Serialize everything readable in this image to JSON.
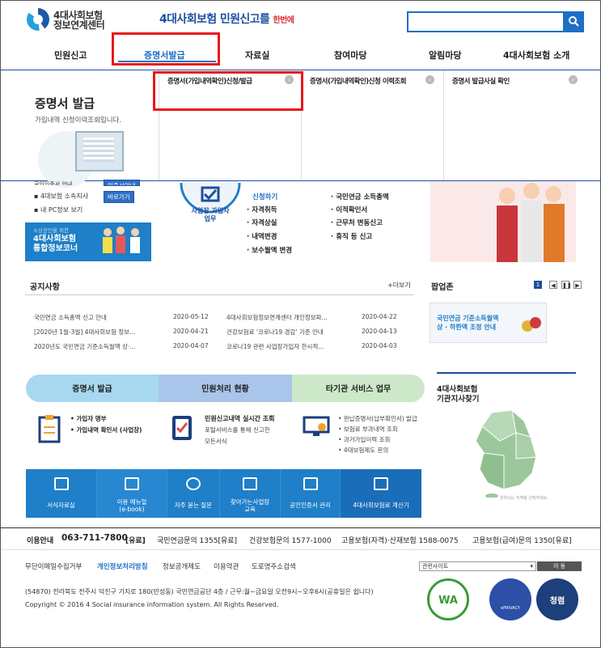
{
  "header": {
    "logo_line1": "4대사회보험",
    "logo_line2": "정보연계센터",
    "slogan_main": "4대사회보험 민원신고를",
    "slogan_small": "한번에",
    "search_placeholder": ""
  },
  "gnb": [
    "민원신고",
    "증명서발급",
    "자료실",
    "참여마당",
    "알림마당",
    "4대사회보험 소개"
  ],
  "dropdown": {
    "title": "증명서 발급",
    "subtitle": "가입내역 신청이력조회입니다.",
    "columns": [
      "증명서(가입내역확인)신청/발급",
      "증명서(가입내역확인)신청 이력조회",
      "증명서 발급사실 확인"
    ]
  },
  "side": {
    "items": [
      "공인인증서 안내",
      "4대보험 소속지사",
      "내 PC정보 보기"
    ],
    "btn1": "인증서안내",
    "btn2": "바로가기",
    "banner_small": "소상공인을 위한",
    "banner_big1": "4대사회보험",
    "banner_big2": "통합정보코너"
  },
  "biz": {
    "badge_line1": "사업장 가입자",
    "badge_line2": "업무",
    "col1": [
      "신청하기",
      "자격취득",
      "자격상실",
      "내역변경",
      "보수월액 변경"
    ],
    "col2": [
      "국민연금 소득총액",
      "이적확인서",
      "근무처 변동신고",
      "휴직 등 신고"
    ]
  },
  "notice": {
    "title": "공지사항",
    "more": "+더보기",
    "rows": [
      [
        "국민연금 소득총액 신고 안내",
        "2020-05-12",
        "4대사회보험정보연계센터 개인정보파...",
        "2020-04-22"
      ],
      [
        "[2020년 1월-3월] 4대사회보험 정보...",
        "2020-04-21",
        "건강보험료 '코로나19 경감' 기준 안내",
        "2020-04-13"
      ],
      [
        "2020년도 국민연금 기준소득월액 상·...",
        "2020-04-07",
        "코로나19 관련 사업장가입자 한시적...",
        "2020-04-03"
      ]
    ]
  },
  "popup": {
    "title": "팝업존",
    "page": "1",
    "banner_line1": "국민연금 기준소득월액",
    "banner_line2": "상 · 하한액 조정 안내"
  },
  "tabs": [
    "증명서 발급",
    "민원처리 현황",
    "타기관 서비스 업무"
  ],
  "services": {
    "cert": [
      "가입자 명부",
      "가입내역 확인서 (사업장)"
    ],
    "status_title": "민원신고내역 실시간 조회",
    "status_desc1": "포털서비스를 통해 신고한",
    "status_desc2": "모든서식",
    "other": [
      "완납증명서(납부확인서) 발급",
      "보험료 부과내역 조회",
      "과거가입이력 조회",
      "4대보험제도 문의"
    ]
  },
  "quick": [
    [
      "서식자료실",
      ""
    ],
    [
      "이용 메뉴얼",
      "(e-book)"
    ],
    [
      "자주 묻는 질문",
      ""
    ],
    [
      "찾아가는사업장",
      "교육"
    ],
    [
      "공인인증서 관리",
      ""
    ],
    [
      "4대사회보험료 계산기",
      ""
    ]
  ],
  "map": {
    "title1": "4대사회보험",
    "title2": "기관지사찾기",
    "hint": "원하시는 지역을 선택하세요."
  },
  "info": {
    "label": "이용안내",
    "phone": "063-711-7800",
    "paid": "[유료]",
    "items": [
      "국민연금문의 1355[유료]",
      "건강보험문의 1577-1000",
      "고용보험(자격)·산재보험 1588-0075",
      "고용보험(급여)문의 1350[유료]"
    ]
  },
  "footer": {
    "links": [
      "무단이메일수집거부",
      "개인정보처리방침",
      "정보공개제도",
      "이용약관",
      "도로명주소검색"
    ],
    "select": "관련사이트",
    "go": "이 동",
    "address": "(54870) 전라북도 전주시 덕진구 기지로 180(만성동) 국민연금공단 4층 / 근무:월~금요일 오전9시~오후6시(공휴일은 쉽니다)",
    "copyright": "Copyright © 2016 4 Social insurance information system. All Rights Reserved.",
    "cert_wa": "WA",
    "cert_privacy": "ePRIVACY",
    "cert_clean": "청렴"
  },
  "colors": {
    "brand_blue": "#1d4f9f",
    "accent_blue": "#1f7fc8",
    "highlight_red": "#e8181c"
  }
}
